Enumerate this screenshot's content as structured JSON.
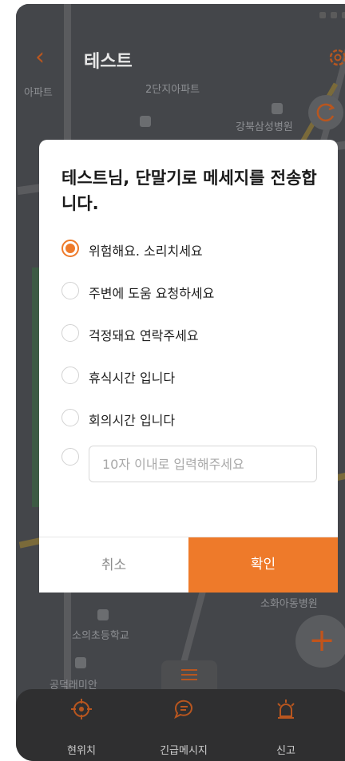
{
  "header": {
    "title": "테스트"
  },
  "map": {
    "labels": [
      "아파트",
      "2단지아파트",
      "강북삼성병원",
      "소의초등학교",
      "공덕래미안",
      "소화아동병원"
    ]
  },
  "dialog": {
    "title": "테스트님, 단말기로 메세지를 전송합니다.",
    "options": [
      {
        "label": "위험해요. 소리치세요",
        "selected": true
      },
      {
        "label": "주변에 도움 요청하세요",
        "selected": false
      },
      {
        "label": "걱정돼요 연락주세요",
        "selected": false
      },
      {
        "label": "휴식시간 입니다",
        "selected": false
      },
      {
        "label": "회의시간 입니다",
        "selected": false
      }
    ],
    "custom_input": {
      "value": "",
      "placeholder": "10자 이내로 입력해주세요"
    },
    "cancel_label": "취소",
    "ok_label": "확인"
  },
  "bottom_nav": {
    "items": [
      {
        "label": "현위치",
        "icon": "location-target-icon"
      },
      {
        "label": "긴급메시지",
        "icon": "message-icon"
      },
      {
        "label": "신고",
        "icon": "siren-icon"
      }
    ]
  },
  "colors": {
    "accent": "#ee7a2a",
    "overlay": "#3a3a3a"
  }
}
